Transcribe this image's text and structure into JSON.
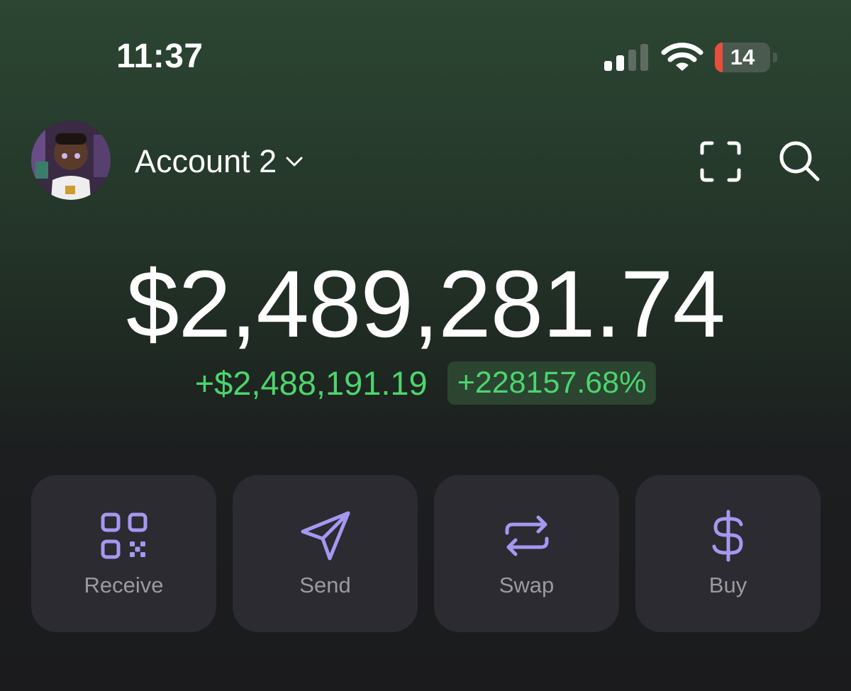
{
  "status_bar": {
    "time": "11:37",
    "battery_level": "14",
    "battery_fraction": 0.14,
    "icons": [
      "cellular-signal-icon",
      "wifi-icon",
      "battery-icon"
    ]
  },
  "header": {
    "account_name": "Account 2",
    "icons": [
      "avatar",
      "chevron-down-icon",
      "scan-icon",
      "search-icon"
    ]
  },
  "portfolio": {
    "balance": "$2,489,281.74",
    "change_amount": "+$2,488,191.19",
    "change_percent": "+228157.68%"
  },
  "actions": [
    {
      "label": "Receive",
      "icon": "qr-code-icon"
    },
    {
      "label": "Send",
      "icon": "paper-plane-icon"
    },
    {
      "label": "Swap",
      "icon": "swap-arrows-icon"
    },
    {
      "label": "Buy",
      "icon": "dollar-icon"
    }
  ],
  "colors": {
    "accent": "#a498f0",
    "positive": "#4dd46d",
    "card": "#2b2b31",
    "battery_low": "#eb4d3d"
  }
}
